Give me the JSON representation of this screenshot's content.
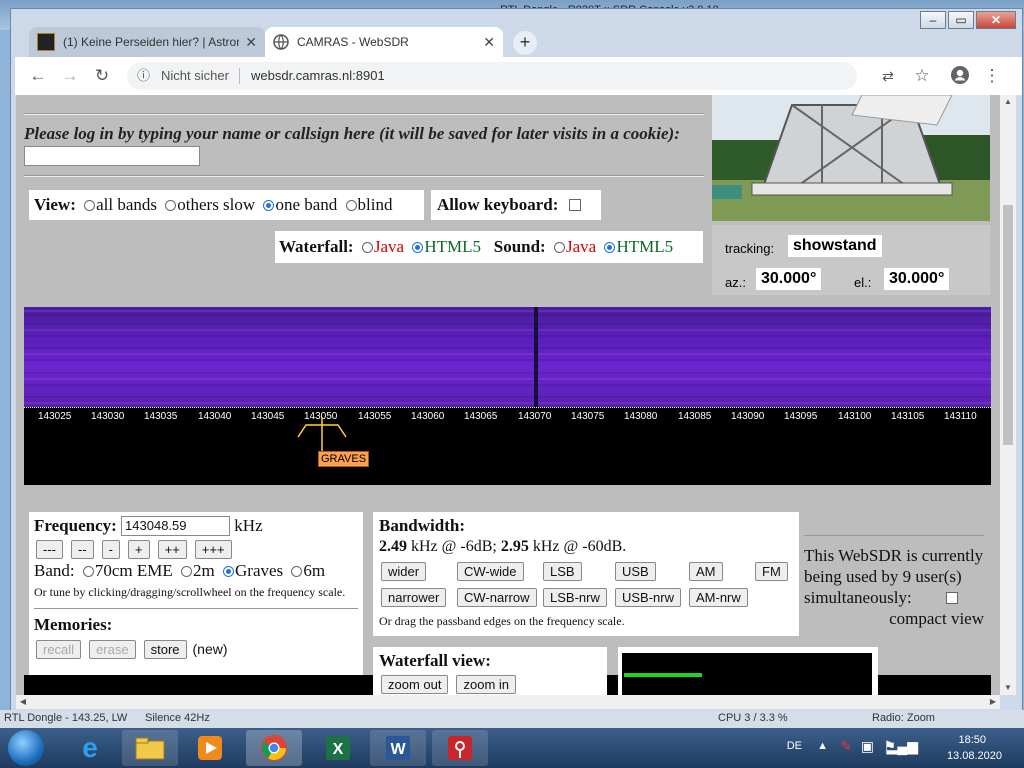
{
  "background_window": {
    "title": "RTL Dongle - R820T :: SDR Console v3.0.10"
  },
  "browser": {
    "tabs": [
      {
        "title": "(1) Keine Perseiden hier? | Astron",
        "active": false
      },
      {
        "title": "CAMRAS - WebSDR",
        "active": true
      }
    ],
    "new_tab_label": "+",
    "security_label": "Nicht sicher",
    "url": "websdr.camras.nl:8901"
  },
  "page": {
    "login_text": "Please log in by typing your name or callsign here (it will be saved for later visits in a cookie):",
    "login_value": "",
    "view": {
      "label": "View:",
      "options": [
        "all bands",
        "others slow",
        "one band",
        "blind"
      ],
      "selected": "one band"
    },
    "allow_keyboard_label": "Allow keyboard:",
    "waterfall_label": "Waterfall:",
    "sound_label": "Sound:",
    "java_label": "Java",
    "html5_label": "HTML5",
    "tracking": {
      "label": "tracking:",
      "value": "showstand"
    },
    "az": {
      "label": "az.:",
      "value": "30.000°"
    },
    "el": {
      "label": "el.:",
      "value": "30.000°"
    },
    "scale_ticks": [
      "143025",
      "143030",
      "143035",
      "143040",
      "143045",
      "143050",
      "143055",
      "143060",
      "143065",
      "143070",
      "143075",
      "143080",
      "143085",
      "143090",
      "143095",
      "143100",
      "143105",
      "143110"
    ],
    "station_label": "GRAVES",
    "frequency": {
      "label": "Frequency:",
      "value": "143048.59",
      "unit": "kHz",
      "step_buttons": [
        "---",
        "--",
        "-",
        "+",
        "++",
        "+++"
      ],
      "band_label": "Band:",
      "bands": [
        "70cm EME",
        "2m",
        "Graves",
        "6m"
      ],
      "selected_band": "Graves",
      "hint": "Or tune by clicking/dragging/scrollwheel on the frequency scale."
    },
    "memories": {
      "label": "Memories:",
      "recall": "recall",
      "erase": "erase",
      "store": "store",
      "new_label": "(new)"
    },
    "bandwidth": {
      "label": "Bandwidth:",
      "value_6db": "2.49",
      "text_6db": " kHz @ -6dB; ",
      "value_60db": "2.95",
      "text_60db": " kHz @ -60dB.",
      "row1": [
        "wider",
        "CW-wide",
        "LSB",
        "USB",
        "AM",
        "FM"
      ],
      "row2": [
        "narrower",
        "CW-narrow",
        "LSB-nrw",
        "USB-nrw",
        "AM-nrw"
      ],
      "hint": "Or drag the passband edges on the frequency scale."
    },
    "users_text": "This WebSDR is currently being used by 9 user(s) simultaneously:",
    "compact_view_label": "compact view",
    "waterfall_view": {
      "label": "Waterfall view:",
      "zoom_out": "zoom out",
      "zoom_in": "zoom in"
    }
  },
  "behind_status": {
    "left": "RTL Dongle - 143.25, LW",
    "mid": "Silence 42Hz",
    "right": "CPU 3 / 3.3 %",
    "far_right": "Radio: Zoom"
  },
  "taskbar": {
    "lang": "DE",
    "time": "18:50",
    "date": "13.08.2020",
    "apps": [
      "ie-icon",
      "explorer-icon",
      "media-player-icon",
      "chrome-icon",
      "excel-icon",
      "word-icon",
      "sdr-icon"
    ]
  }
}
